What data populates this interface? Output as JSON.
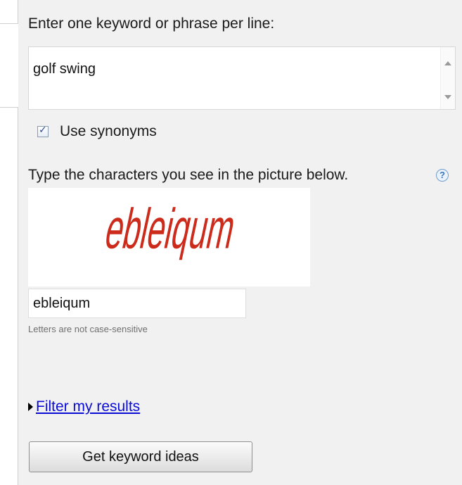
{
  "keywords": {
    "label": "Enter one keyword or phrase per line:",
    "value": "golf swing"
  },
  "synonyms": {
    "label": "Use synonyms",
    "checked": true
  },
  "captcha": {
    "prompt": "Type the characters you see in the picture below.",
    "image_text": "ebleiqum",
    "image_color": "#cc2a1a",
    "input_value": "ebleiqum",
    "hint": "Letters are not case-sensitive"
  },
  "filter": {
    "link_label": "Filter my results"
  },
  "submit": {
    "label": "Get keyword ideas"
  },
  "icons": {
    "help": "?",
    "check": "✓"
  }
}
